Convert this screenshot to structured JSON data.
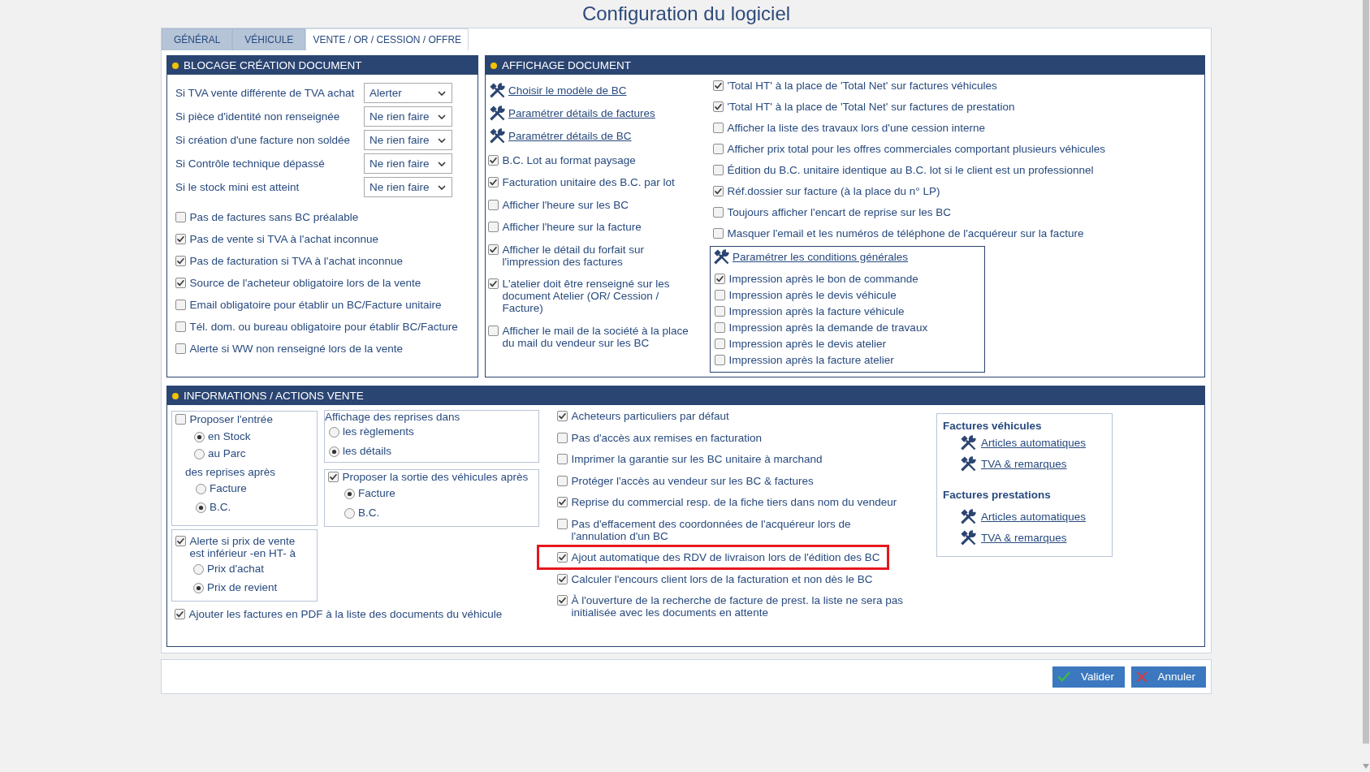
{
  "window": {
    "title": "Configuration du logiciel"
  },
  "tabs": [
    {
      "label": "GÉNÉRAL",
      "selected": false
    },
    {
      "label": "VÉHICULE",
      "selected": false
    },
    {
      "label": "VENTE / OR / CESSION / OFFRE",
      "selected": true
    }
  ],
  "blocage_creation_document": {
    "title": "BLOCAGE CRÉATION DOCUMENT",
    "rules": [
      {
        "label": "Si TVA vente différente de TVA achat",
        "value": "Alerter"
      },
      {
        "label": "Si pièce d'identité non renseignée",
        "value": "Ne rien faire"
      },
      {
        "label": "Si création d'une facture non soldée",
        "value": "Ne rien faire"
      },
      {
        "label": "Si Contrôle technique dépassé",
        "value": "Ne rien faire"
      },
      {
        "label": "Si le stock mini est atteint",
        "value": "Ne rien faire"
      }
    ],
    "options": [
      {
        "label": "Pas de factures sans BC préalable",
        "checked": false
      },
      {
        "label": "Pas de vente si TVA à l'achat inconnue",
        "checked": true
      },
      {
        "label": "Pas de facturation si TVA à l'achat inconnue",
        "checked": true
      },
      {
        "label": "Source de l'acheteur obligatoire lors de la vente",
        "checked": true
      },
      {
        "label": "Email obligatoire pour établir un BC/Facture unitaire",
        "checked": false
      },
      {
        "label": "Tél. dom. ou bureau obligatoire pour établir BC/Facture",
        "checked": false
      },
      {
        "label": "Alerte si WW non renseigné lors de la vente",
        "checked": false
      }
    ]
  },
  "affichage_document": {
    "title": "AFFICHAGE DOCUMENT",
    "left_items": [
      {
        "kind": "link",
        "label": "Choisir le modèle de BC"
      },
      {
        "kind": "link",
        "label": "Paramétrer détails de factures"
      },
      {
        "kind": "link",
        "label": "Paramétrer détails de BC"
      },
      {
        "kind": "checkbox",
        "label": "B.C. Lot au format paysage",
        "checked": true
      },
      {
        "kind": "checkbox",
        "label": "Facturation unitaire des B.C. par lot",
        "checked": true
      },
      {
        "kind": "checkbox",
        "label": "Afficher l'heure sur les BC",
        "checked": false
      },
      {
        "kind": "checkbox",
        "label": "Afficher l'heure sur la facture",
        "checked": false
      },
      {
        "kind": "checkbox",
        "label": "Afficher le détail du forfait sur l'impression des factures",
        "checked": true
      },
      {
        "kind": "checkbox",
        "label": "L'atelier doit être renseigné sur les document Atelier (OR/ Cession / Facture)",
        "checked": true
      },
      {
        "kind": "checkbox",
        "label": "Afficher le mail de la société à la place du mail du vendeur sur les BC",
        "checked": false
      }
    ],
    "right_items": [
      {
        "label": "'Total HT' à la place de 'Total Net' sur factures véhicules",
        "checked": true
      },
      {
        "label": "'Total HT' à la place de 'Total Net' sur factures de prestation",
        "checked": true
      },
      {
        "label": "Afficher la liste des travaux lors d'une cession interne",
        "checked": false
      },
      {
        "label": "Afficher prix total pour les offres commerciales comportant plusieurs véhicules",
        "checked": false
      },
      {
        "label": "Édition du B.C. unitaire identique au B.C. lot si le client est un professionnel",
        "checked": false
      },
      {
        "label": "Réf.dossier sur facture (à la place du n° LP)",
        "checked": true
      },
      {
        "label": "Toujours afficher l'encart de reprise sur les BC",
        "checked": false
      },
      {
        "label": "Masquer l'email et les numéros de téléphone de l'acquéreur sur la facture",
        "checked": false
      }
    ],
    "conditions_generales": {
      "link": "Paramétrer les conditions générales",
      "options": [
        {
          "label": "Impression après le bon de commande",
          "checked": true
        },
        {
          "label": "Impression après le devis véhicule",
          "checked": false
        },
        {
          "label": "Impression après la facture véhicule",
          "checked": false
        },
        {
          "label": "Impression après la demande de travaux",
          "checked": false
        },
        {
          "label": "Impression après le devis atelier",
          "checked": false
        },
        {
          "label": "Impression après la facture atelier",
          "checked": false
        }
      ]
    }
  },
  "informations_actions_vente": {
    "title": "INFORMATIONS / ACTIONS VENTE",
    "proposer_entree": {
      "label": "Proposer l'entrée",
      "checked": false,
      "location_options": [
        {
          "label": "en Stock",
          "selected": true
        },
        {
          "label": "au Parc",
          "selected": false
        }
      ],
      "after_label": "des reprises après",
      "after_options": [
        {
          "label": "Facture",
          "selected": false
        },
        {
          "label": "B.C.",
          "selected": true
        }
      ]
    },
    "affichage_reprises": {
      "title": "Affichage des reprises dans",
      "options": [
        {
          "label": "les règlements",
          "selected": false
        },
        {
          "label": "les détails",
          "selected": true
        }
      ]
    },
    "sortie_vehicules": {
      "label": "Proposer la sortie des véhicules après",
      "checked": true,
      "options": [
        {
          "label": "Facture",
          "selected": true
        },
        {
          "label": "B.C.",
          "selected": false
        }
      ]
    },
    "alerte_prix": {
      "label": "Alerte si prix de vente est inférieur -en HT- à",
      "checked": true,
      "options": [
        {
          "label": "Prix d'achat",
          "selected": false
        },
        {
          "label": "Prix de revient",
          "selected": true
        }
      ]
    },
    "ajouter_pdf": {
      "label": "Ajouter les factures en PDF à la liste des documents du véhicule",
      "checked": true
    },
    "options": [
      {
        "label": "Acheteurs particuliers par défaut",
        "checked": true,
        "highlighted": false
      },
      {
        "label": "Pas d'accès aux remises en facturation",
        "checked": false,
        "highlighted": false
      },
      {
        "label": "Imprimer la garantie sur les BC unitaire à marchand",
        "checked": false,
        "highlighted": false
      },
      {
        "label": "Protéger l'accès au vendeur sur les BC & factures",
        "checked": false,
        "highlighted": false
      },
      {
        "label": "Reprise du commercial resp. de la fiche tiers dans nom du vendeur",
        "checked": true,
        "highlighted": false
      },
      {
        "label": "Pas d'effacement des coordonnées de l'acquéreur lors de l'annulation d'un BC",
        "checked": false,
        "highlighted": false
      },
      {
        "label": "Ajout automatique des RDV de livraison lors de l'édition des BC",
        "checked": true,
        "highlighted": true
      },
      {
        "label": "Calculer l'encours client lors de la facturation et non dès le BC",
        "checked": true,
        "highlighted": false
      },
      {
        "label": "À l'ouverture de la recherche de facture de prest. la liste ne sera pas initialisée avec les documents en attente",
        "checked": true,
        "highlighted": false
      }
    ],
    "invoice_settings": [
      {
        "heading": "Factures véhicules",
        "links": [
          "Articles automatiques",
          "TVA & remarques"
        ]
      },
      {
        "heading": "Factures prestations",
        "links": [
          "Articles automatiques",
          "TVA & remarques"
        ]
      }
    ]
  },
  "buttons": [
    {
      "kind": "confirm",
      "label": "Valider"
    },
    {
      "kind": "cancel",
      "label": "Annuler"
    }
  ]
}
